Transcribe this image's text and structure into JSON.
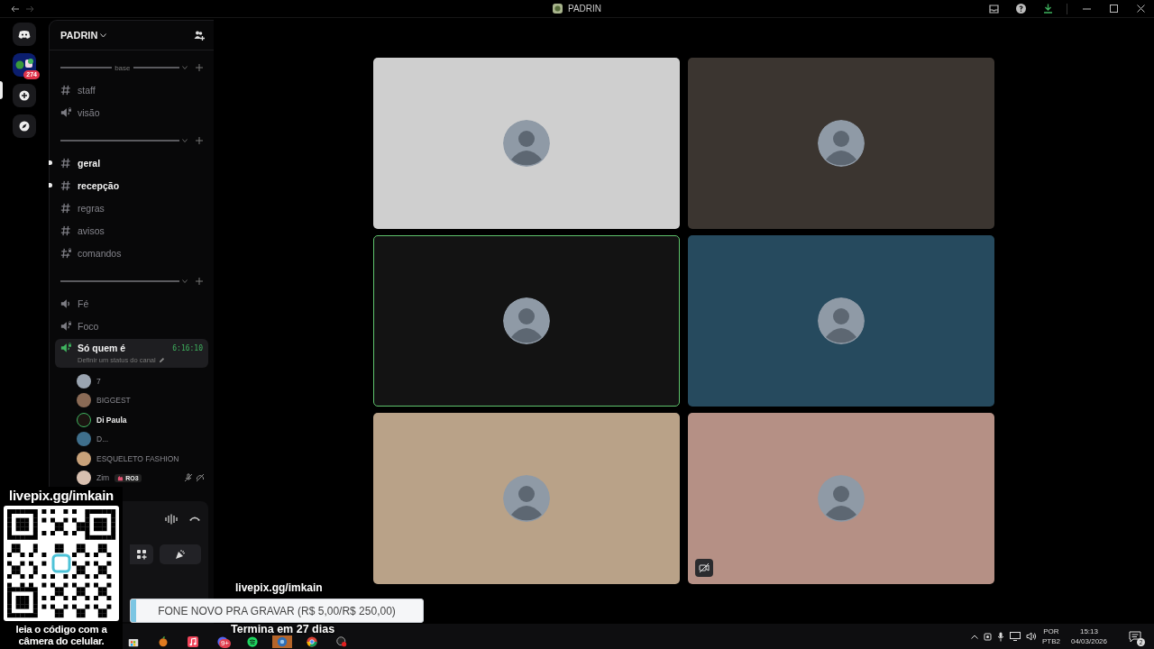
{
  "title_bar": {
    "server_name": "PADRIN"
  },
  "server_rail": {
    "folder_badge": "274"
  },
  "sidebar": {
    "server_name": "PADRIN",
    "categories": [
      {
        "name": "base",
        "channels": [
          {
            "kind": "text",
            "name": "staff",
            "unread": false,
            "locked": false
          },
          {
            "kind": "voice",
            "name": "visão",
            "unread": false,
            "locked": true
          }
        ]
      },
      {
        "channels": [
          {
            "kind": "text",
            "name": "geral",
            "unread": true,
            "locked": false
          },
          {
            "kind": "text",
            "name": "recepção",
            "unread": true,
            "locked": false
          },
          {
            "kind": "text",
            "name": "regras",
            "unread": false,
            "locked": false
          },
          {
            "kind": "text",
            "name": "avisos",
            "unread": false,
            "locked": false
          },
          {
            "kind": "text",
            "name": "comandos",
            "unread": false,
            "locked": true
          }
        ]
      },
      {
        "channels": [
          {
            "kind": "voice",
            "name": "Fé",
            "unread": false,
            "locked": false
          },
          {
            "kind": "voice",
            "name": "Foco",
            "unread": false,
            "locked": true
          },
          {
            "kind": "voice",
            "name": "Só quem é",
            "locked": true,
            "selected": true,
            "timer": "6:16:10",
            "status": "Definir um status do canal",
            "members": [
              {
                "name": "7",
                "color": "#9aa4b0",
                "speaking": false,
                "muted": false,
                "deafened": false
              },
              {
                "name": "BIGGEST",
                "color": "#8a6a55",
                "speaking": false,
                "muted": false,
                "deafened": false
              },
              {
                "name": "Di Paula",
                "color": "#1a1410",
                "speaking": true,
                "muted": false,
                "deafened": false
              },
              {
                "name": "D...",
                "color": "#3f6f8c",
                "speaking": false,
                "muted": false,
                "deafened": false
              },
              {
                "name": "ESQUELETO FASHION",
                "color": "#c9a27a",
                "speaking": false,
                "muted": false,
                "deafened": false
              },
              {
                "name": "Zim",
                "color": "#d8c0b0",
                "speaking": false,
                "muted": true,
                "deafened": true,
                "badge": "RO3"
              }
            ]
          }
        ]
      }
    ]
  },
  "video_tiles": [
    {
      "color": "#cfcfcf",
      "speaking": false,
      "camera_off": false
    },
    {
      "color": "#3b3530",
      "speaking": false,
      "camera_off": false
    },
    {
      "color": "#131313",
      "speaking": true,
      "camera_off": false
    },
    {
      "color": "#264a5e",
      "speaking": false,
      "camera_off": false
    },
    {
      "color": "#b9a288",
      "speaking": false,
      "camera_off": false
    },
    {
      "color": "#b59085",
      "speaking": false,
      "camera_off": true
    }
  ],
  "overlay": {
    "link": "livepix.gg/imkain",
    "qr_caption": "leia o código com a câmera do celular.",
    "goal_link": "livepix.gg/imkain",
    "goal_text": "FONE NOVO PRA GRAVAR (R$ 5,00/R$ 250,00)",
    "level": 0.02,
    "goal_ends": "Termina em 27 dias"
  },
  "taskbar": {
    "apps": [
      {
        "kind": "store",
        "selected": false
      },
      {
        "kind": "fruit",
        "selected": false
      },
      {
        "kind": "music",
        "selected": false
      },
      {
        "kind": "chat",
        "selected": false,
        "badge": "9+"
      },
      {
        "kind": "green",
        "selected": false
      },
      {
        "kind": "blue",
        "selected": true
      },
      {
        "kind": "browser",
        "selected": false
      },
      {
        "kind": "record",
        "selected": false
      }
    ],
    "tray": {
      "language": "POR",
      "layout": "PTB2",
      "time": "15:13",
      "date": "04/03/2026",
      "notifications": "2"
    }
  }
}
